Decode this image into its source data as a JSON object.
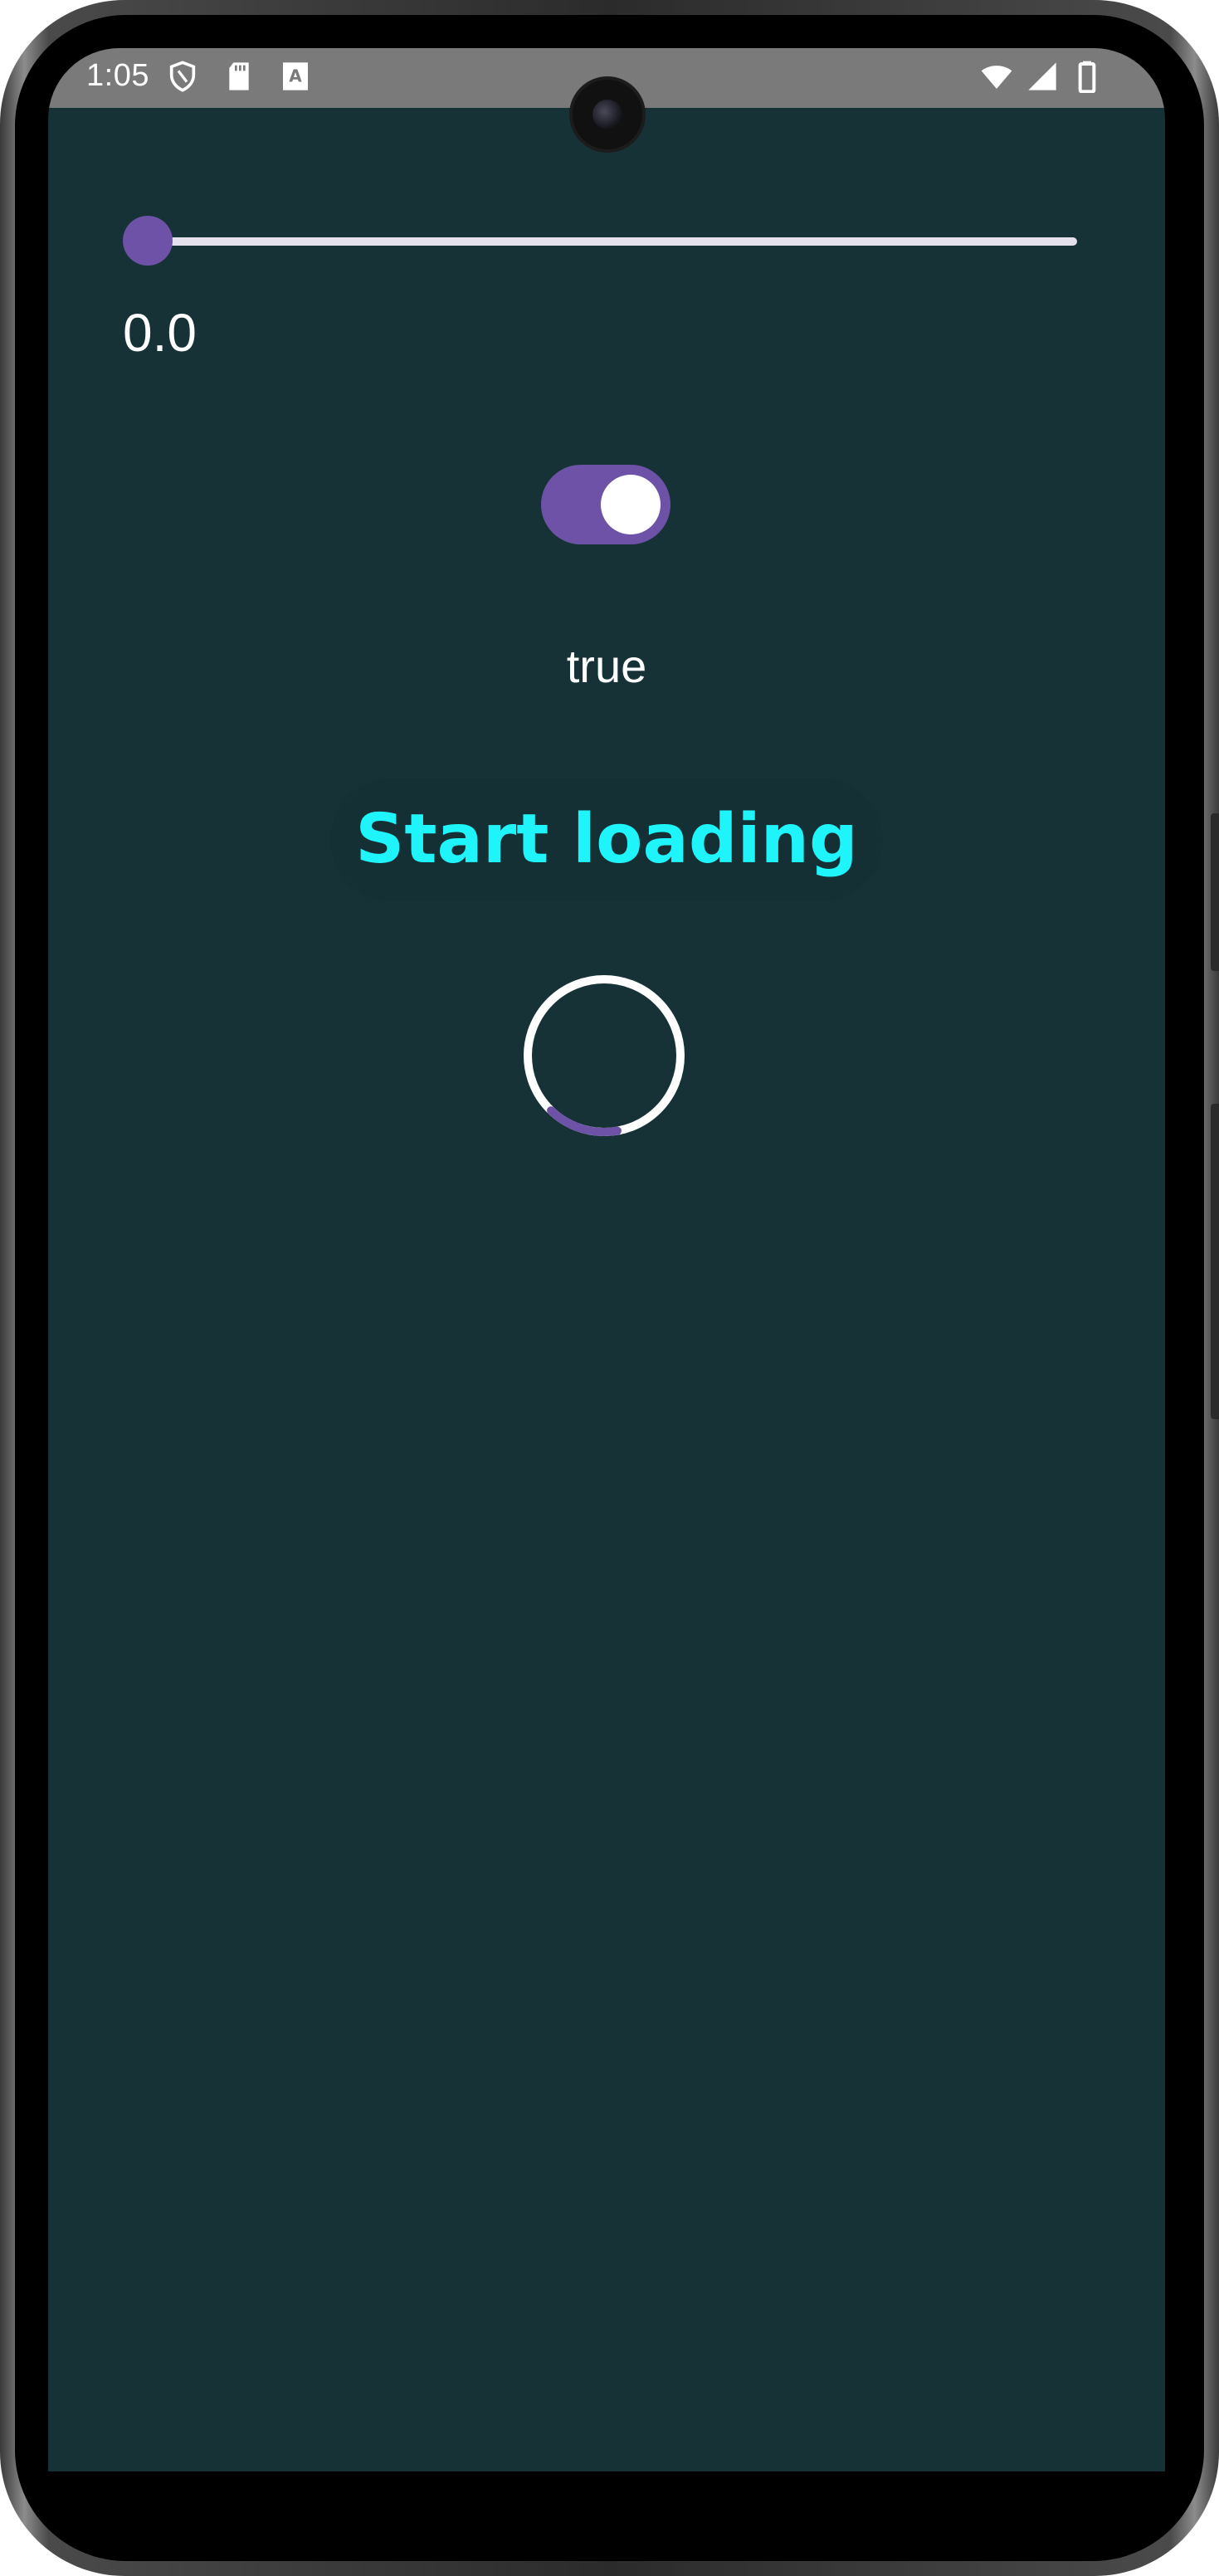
{
  "status_bar": {
    "time": "1:05",
    "left_icons": [
      "shield-icon",
      "sd-card-icon",
      "keyboard-a-icon"
    ],
    "right_icons": [
      "wifi-icon",
      "signal-icon",
      "battery-icon"
    ]
  },
  "slider": {
    "value": 0.0,
    "value_text": "0.0"
  },
  "switch": {
    "checked": true,
    "state_text": "true"
  },
  "button": {
    "label": "Start loading"
  },
  "progress": {
    "type": "circular",
    "fraction": 0.15
  },
  "colors": {
    "background": "#163237",
    "accent": "#6d52a8",
    "button_text": "#1ff4fb",
    "text": "#ffffff"
  }
}
